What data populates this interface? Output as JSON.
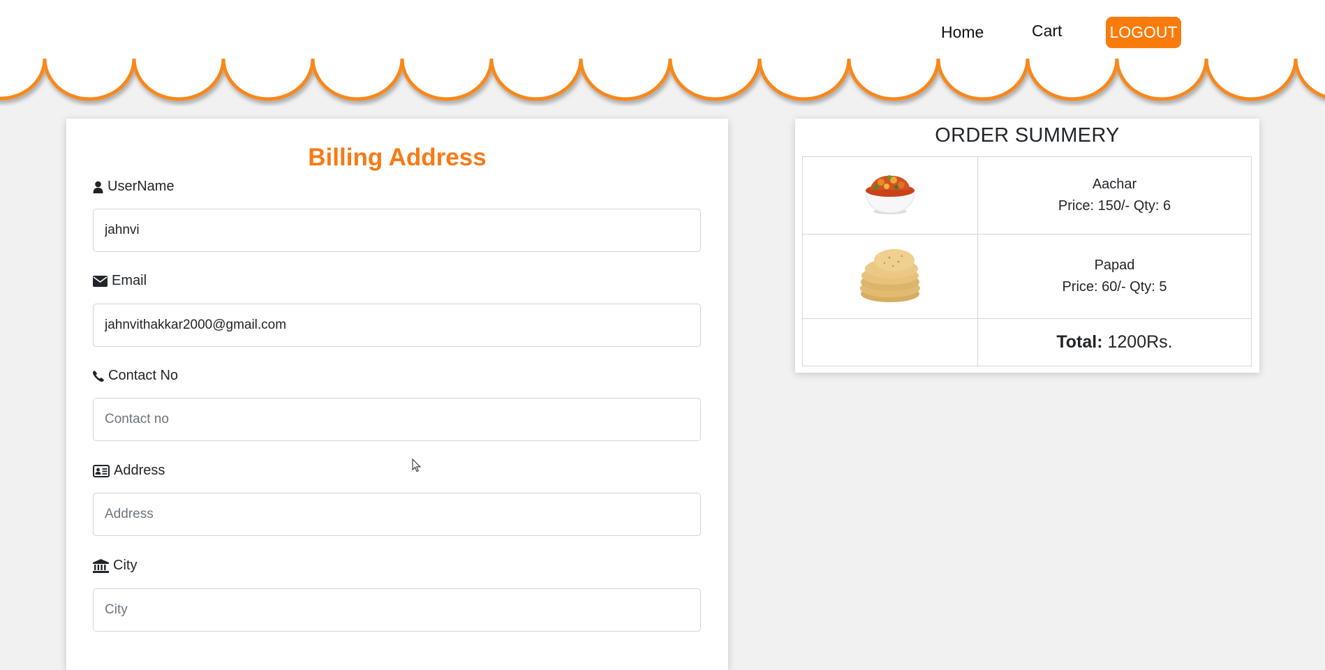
{
  "nav": {
    "home": "Home",
    "cart": "Cart",
    "logout": "LOGOUT"
  },
  "colors": {
    "accent": "#f77a14",
    "button": "#f97b0c",
    "background": "#f1f1f1"
  },
  "billing": {
    "title": "Billing Address",
    "fields": [
      {
        "label": "UserName",
        "icon": "user-icon",
        "value": "jahnvi",
        "placeholder": ""
      },
      {
        "label": "Email",
        "icon": "envelope-icon",
        "value": "jahnvithakkar2000@gmail.com",
        "placeholder": ""
      },
      {
        "label": "Contact No",
        "icon": "phone-icon",
        "value": "",
        "placeholder": "Contact no"
      },
      {
        "label": "Address",
        "icon": "address-card-icon",
        "value": "",
        "placeholder": "Address"
      },
      {
        "label": "City",
        "icon": "bank-icon",
        "value": "",
        "placeholder": "City"
      }
    ]
  },
  "order_summary": {
    "title": "ORDER SUMMERY",
    "items": [
      {
        "name": "Aachar",
        "details": "Price: 150/- Qty: 6",
        "image": "aachar-bowl-image"
      },
      {
        "name": "Papad",
        "details": "Price: 60/- Qty: 5",
        "image": "papad-stack-image"
      }
    ],
    "total_label": "Total:",
    "total_value": "1200Rs."
  }
}
